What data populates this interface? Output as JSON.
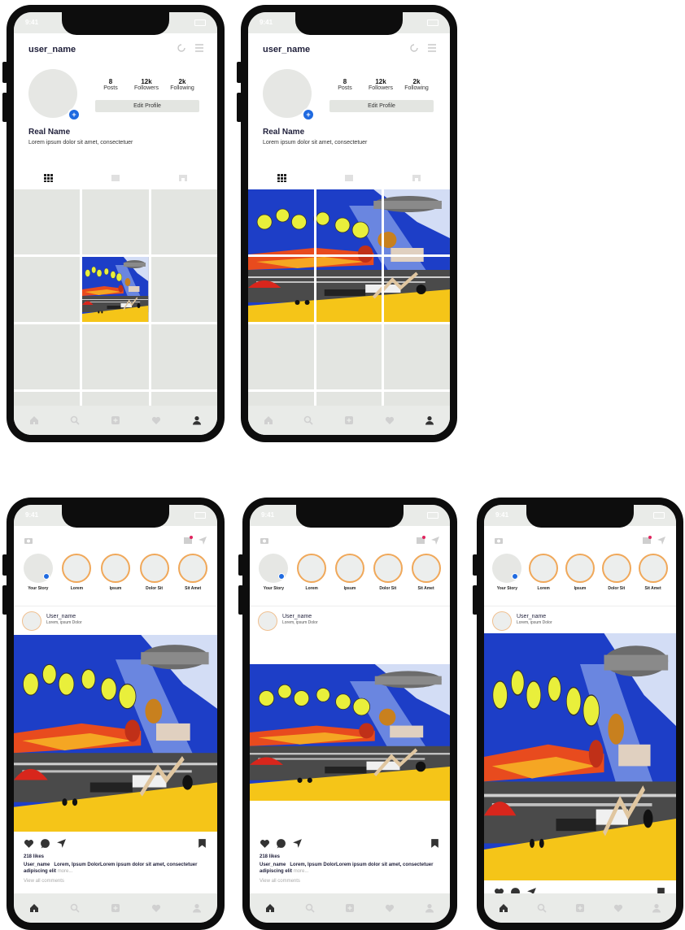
{
  "status": {
    "time": "9:41"
  },
  "profile": {
    "username": "user_name",
    "posts_count": "8",
    "posts_label": "Posts",
    "followers_count": "12k",
    "followers_label": "Followers",
    "following_count": "2k",
    "following_label": "Following",
    "edit_label": "Edit Profile",
    "real_name": "Real Name",
    "bio": "Lorem ipsum dolor sit amet, consectetuer"
  },
  "feed": {
    "stories": [
      "Your Story",
      "Lorem",
      "Ipsum",
      "Dolor Sit",
      "Sit Amet"
    ],
    "post_user": "User_name",
    "post_sub": "Lorem, ipsum Dolor",
    "likes": "218 likes",
    "caption_user": "User_name",
    "caption_text": "Lorem, Ipsum DolorLorem ipsum dolor sit amet, consectetuer adipiscing elit",
    "more": "more...",
    "view_all": "View all comments"
  },
  "colors": {
    "collage_blue": "#1d3ec7",
    "collage_yellow": "#f5c518",
    "balloon": "#e9ef3b",
    "accent_blue": "#1f6ae0",
    "ring": "#f0a85a",
    "gray": "#e3e5e1"
  },
  "icons": [
    "home-icon",
    "search-icon",
    "add-post-icon",
    "heart-icon",
    "profile-icon",
    "camera-icon",
    "send-icon",
    "grid-icon",
    "reels-icon",
    "tagged-icon",
    "comment-icon",
    "bookmark-icon",
    "history-icon",
    "menu-icon"
  ]
}
